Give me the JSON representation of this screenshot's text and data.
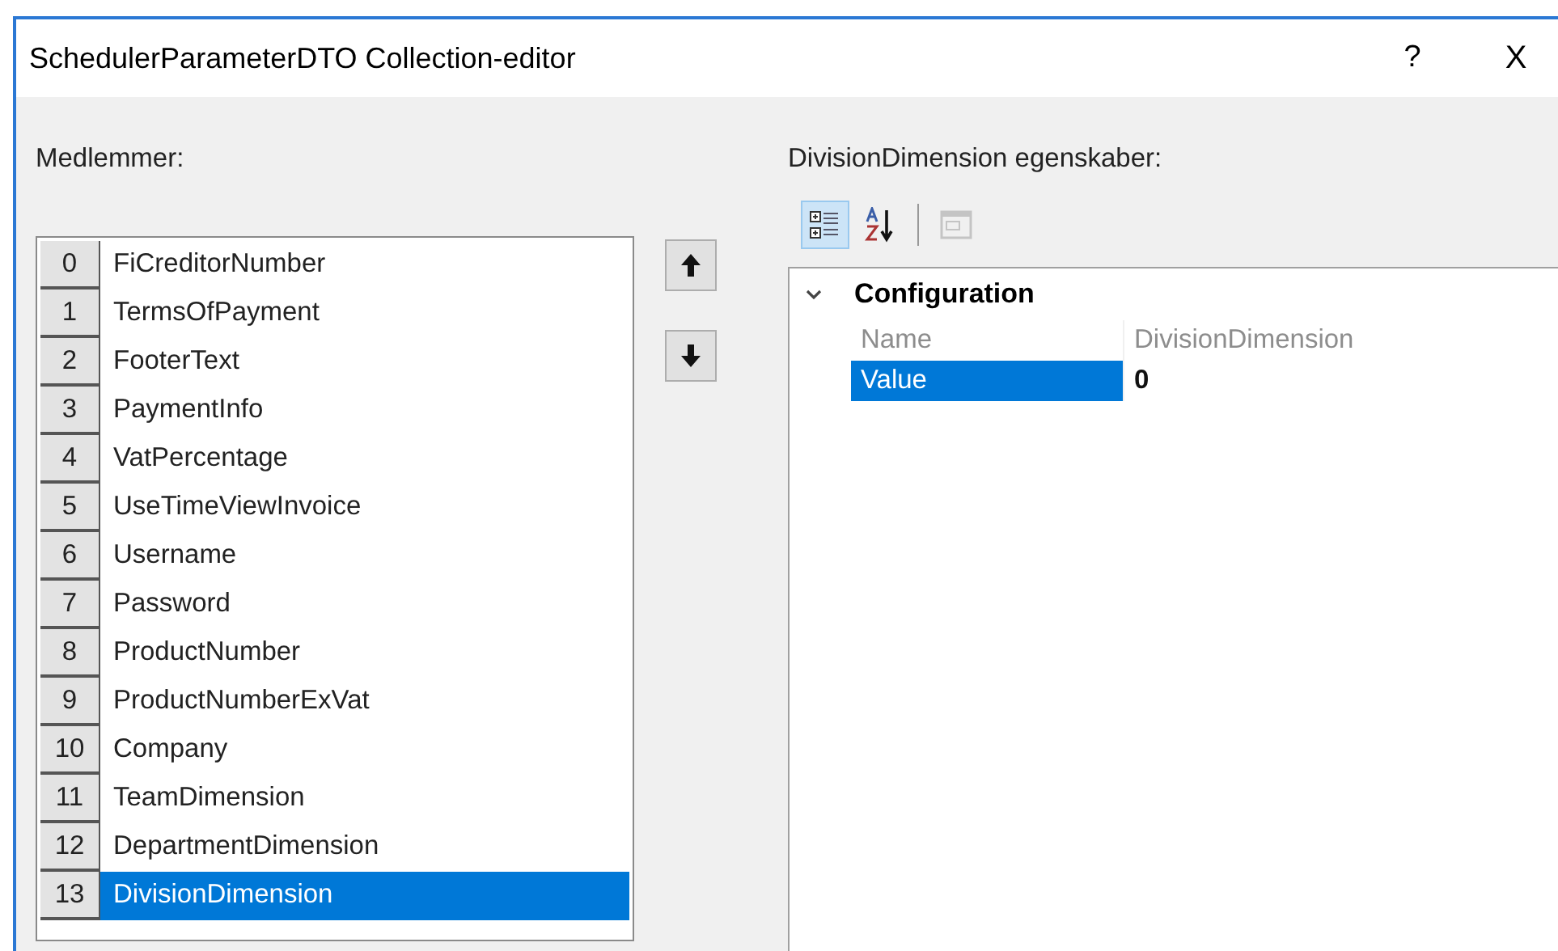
{
  "window": {
    "title": "SchedulerParameterDTO Collection-editor",
    "help_button": "?",
    "close_button": "X"
  },
  "members": {
    "label": "Medlemmer:",
    "items": [
      {
        "index": "0",
        "name": "FiCreditorNumber",
        "selected": false
      },
      {
        "index": "1",
        "name": "TermsOfPayment",
        "selected": false
      },
      {
        "index": "2",
        "name": "FooterText",
        "selected": false
      },
      {
        "index": "3",
        "name": "PaymentInfo",
        "selected": false
      },
      {
        "index": "4",
        "name": "VatPercentage",
        "selected": false
      },
      {
        "index": "5",
        "name": "UseTimeViewInvoice",
        "selected": false
      },
      {
        "index": "6",
        "name": "Username",
        "selected": false
      },
      {
        "index": "7",
        "name": "Password",
        "selected": false
      },
      {
        "index": "8",
        "name": "ProductNumber",
        "selected": false
      },
      {
        "index": "9",
        "name": "ProductNumberExVat",
        "selected": false
      },
      {
        "index": "10",
        "name": "Company",
        "selected": false
      },
      {
        "index": "11",
        "name": "TeamDimension",
        "selected": false
      },
      {
        "index": "12",
        "name": "DepartmentDimension",
        "selected": false
      },
      {
        "index": "13",
        "name": "DivisionDimension",
        "selected": true
      }
    ]
  },
  "properties": {
    "label": "DivisionDimension egenskaber:",
    "toolbar": {
      "categorized_selected": true,
      "alphabetical_selected": false,
      "property_pages_disabled": true
    },
    "category": {
      "name": "Configuration",
      "expanded": true
    },
    "rows": [
      {
        "name": "Name",
        "value": "DivisionDimension",
        "disabled": true,
        "selected": false,
        "modified": false
      },
      {
        "name": "Value",
        "value": "0",
        "disabled": false,
        "selected": true,
        "modified": true
      }
    ]
  }
}
